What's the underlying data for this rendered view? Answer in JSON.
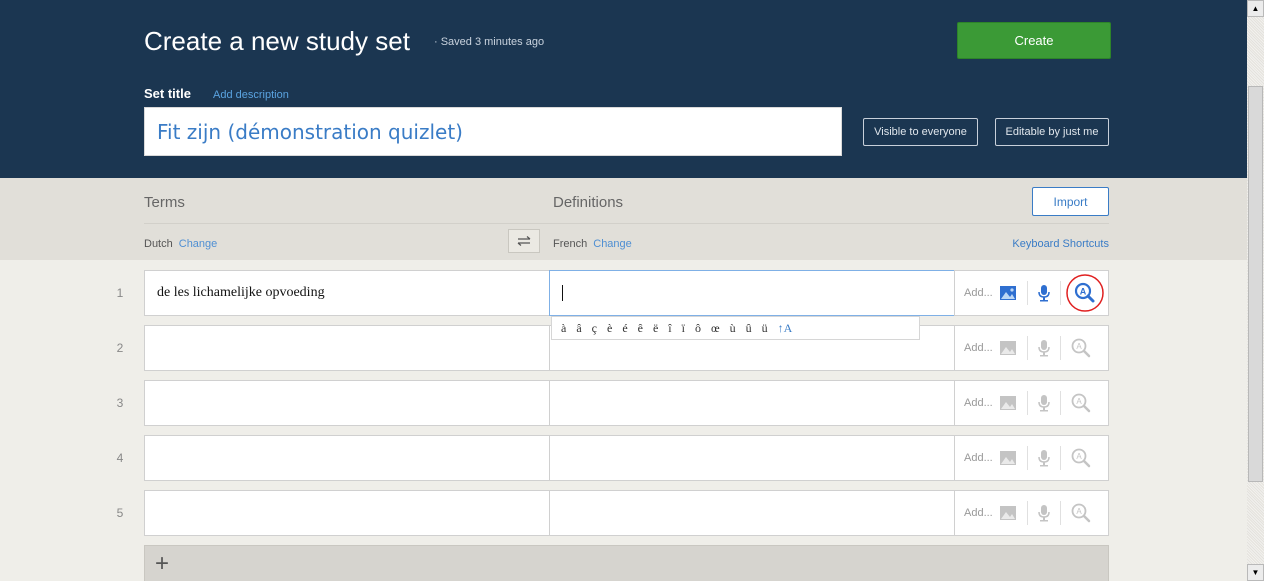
{
  "header": {
    "title": "Create a new study set",
    "saved": "·  Saved 3 minutes ago",
    "create_label": "Create",
    "set_title_label": "Set title",
    "add_description": "Add description",
    "title_value": "Fit zijn (démonstration quizlet)",
    "visible_label": "Visible to everyone",
    "editable_label": "Editable by just me"
  },
  "columns": {
    "terms": "Terms",
    "definitions": "Definitions",
    "import_label": "Import",
    "term_language": "Dutch",
    "def_language": "French",
    "change": "Change",
    "keyboard_shortcuts": "Keyboard Shortcuts"
  },
  "rows": [
    {
      "num": "1",
      "term": "de les lichamelijke opvoeding",
      "definition": ""
    },
    {
      "num": "2",
      "term": "",
      "definition": ""
    },
    {
      "num": "3",
      "term": "",
      "definition": ""
    },
    {
      "num": "4",
      "term": "",
      "definition": ""
    },
    {
      "num": "5",
      "term": "",
      "definition": ""
    }
  ],
  "tools": {
    "add_label": "Add..."
  },
  "accents": [
    "à",
    "â",
    "ç",
    "è",
    "é",
    "ê",
    "ë",
    "î",
    "ï",
    "ô",
    "œ",
    "ù",
    "û",
    "ü",
    "↑A"
  ],
  "add_row_label": "+",
  "colors": {
    "header_bg": "#1b3651",
    "create_green": "#3b9a36",
    "link_blue": "#3a7cc6",
    "active_icon": "#2f6fd0",
    "inactive_icon": "#c4c4c4",
    "highlight_circle": "#e02020"
  }
}
